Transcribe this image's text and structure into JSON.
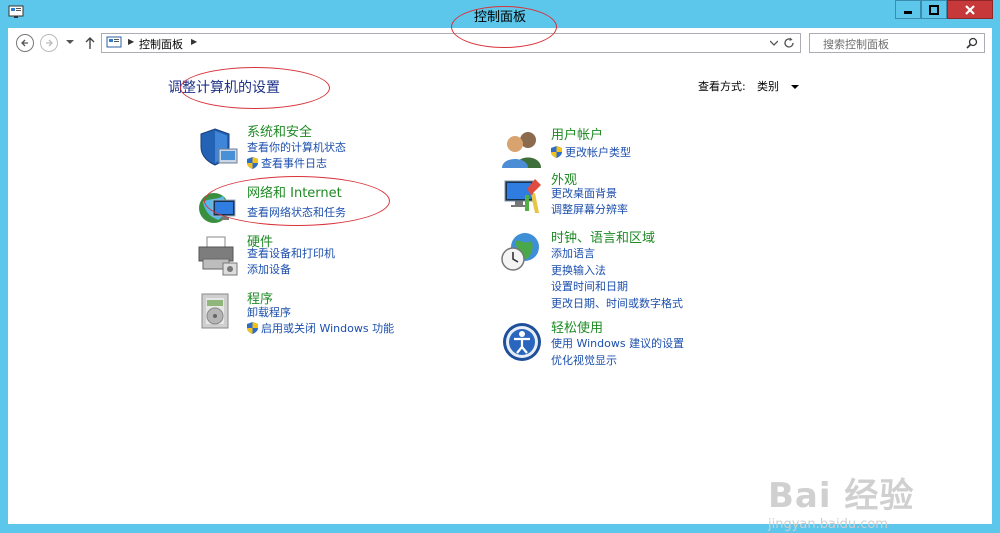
{
  "window": {
    "title": "控制面板"
  },
  "address": {
    "crumb": "控制面板"
  },
  "search": {
    "placeholder": "搜索控制面板"
  },
  "main": {
    "heading": "调整计算机的设置",
    "view_label": "查看方式:",
    "view_value": "类别"
  },
  "categories": [
    {
      "title": "系统和安全",
      "links": [
        "查看你的计算机状态",
        "查看事件日志"
      ]
    },
    {
      "title": "网络和 Internet",
      "links": [
        "查看网络状态和任务"
      ]
    },
    {
      "title": "硬件",
      "links": [
        "查看设备和打印机",
        "添加设备"
      ]
    },
    {
      "title": "程序",
      "links": [
        "卸载程序",
        "启用或关闭 Windows 功能"
      ]
    },
    {
      "title": "用户帐户",
      "links": [
        "更改帐户类型"
      ]
    },
    {
      "title": "外观",
      "links": [
        "更改桌面背景",
        "调整屏幕分辨率"
      ]
    },
    {
      "title": "时钟、语言和区域",
      "links": [
        "添加语言",
        "更换输入法",
        "设置时间和日期",
        "更改日期、时间或数字格式"
      ]
    },
    {
      "title": "轻松使用",
      "links": [
        "使用 Windows 建议的设置",
        "优化视觉显示"
      ]
    }
  ],
  "watermark": {
    "brand": "Bai 经验",
    "url": "jingyan.baidu.com"
  },
  "colors": {
    "frame": "#5cc7eb",
    "category_title": "#1f8a24",
    "link": "#1c4fad",
    "close": "#c7383a",
    "annotation": "#d8333a"
  }
}
